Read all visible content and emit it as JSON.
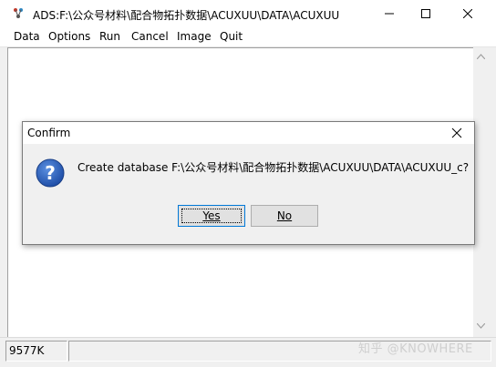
{
  "window": {
    "title": "ADS:F:\\公众号材料\\配合物拓扑数据\\ACUXUU\\DATA\\ACUXUU"
  },
  "menu": [
    "Data",
    "Options",
    "Run",
    "Cancel",
    "Image",
    "Quit"
  ],
  "dialog": {
    "title": "Confirm",
    "message": "Create database F:\\公众号材料\\配合物拓扑数据\\ACUXUU\\DATA\\ACUXUU_c?",
    "yes_label": "Yes",
    "no_label": "No"
  },
  "status": {
    "memory": "9577K"
  },
  "watermark": "知乎 @KNOWHERE"
}
